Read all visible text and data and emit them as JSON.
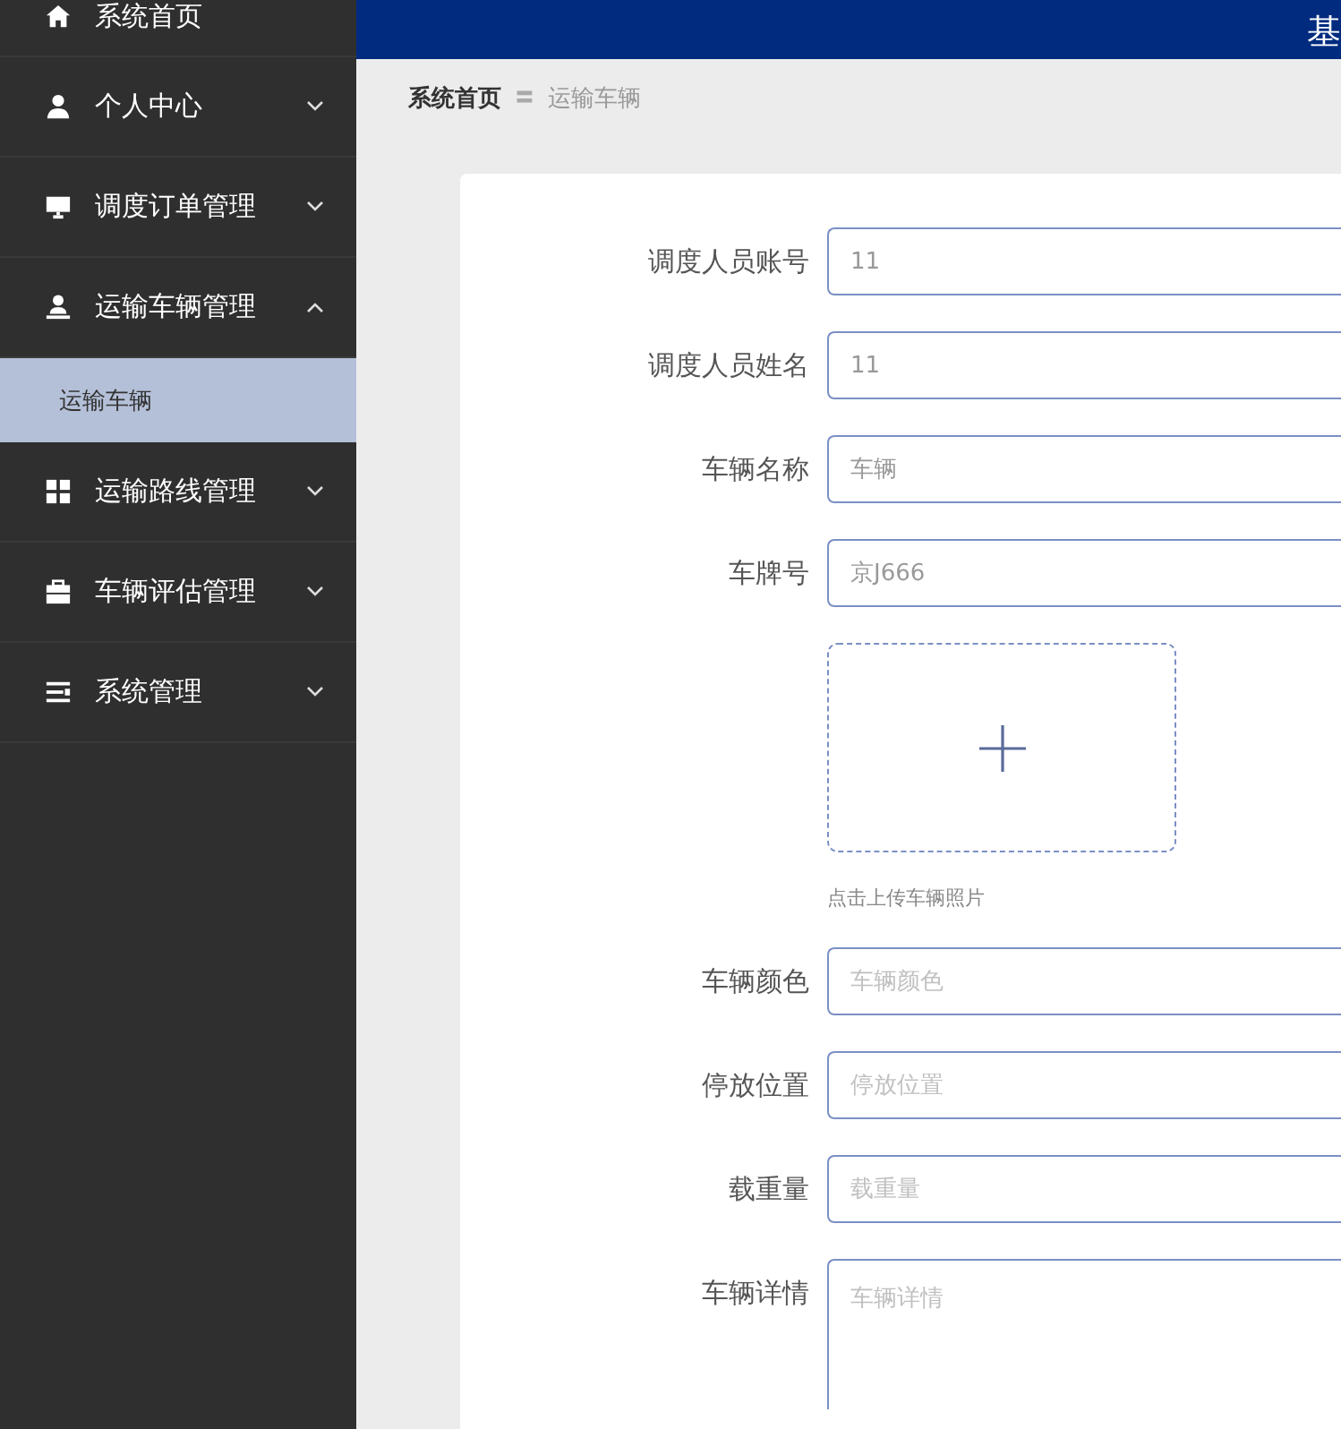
{
  "header": {
    "title": "基"
  },
  "sidebar": {
    "items": [
      {
        "label": "系统首页",
        "kind": "link"
      },
      {
        "label": "个人中心",
        "kind": "menu",
        "expanded": false
      },
      {
        "label": "调度订单管理",
        "kind": "menu",
        "expanded": false
      },
      {
        "label": "运输车辆管理",
        "kind": "menu",
        "expanded": true,
        "children": [
          {
            "label": "运输车辆",
            "selected": true
          }
        ]
      },
      {
        "label": "运输路线管理",
        "kind": "menu",
        "expanded": false
      },
      {
        "label": "车辆评估管理",
        "kind": "menu",
        "expanded": false
      },
      {
        "label": "系统管理",
        "kind": "menu",
        "expanded": false
      }
    ]
  },
  "breadcrumb": {
    "items": [
      "系统首页",
      "运输车辆"
    ],
    "separator": "〓"
  },
  "form": {
    "fields": [
      {
        "kind": "input",
        "label": "调度人员账号",
        "value": "11"
      },
      {
        "kind": "input",
        "label": "调度人员姓名",
        "value": "11"
      },
      {
        "kind": "input",
        "label": "车辆名称",
        "value": "车辆"
      },
      {
        "kind": "input",
        "label": "车牌号",
        "value": "京J666"
      },
      {
        "kind": "upload",
        "hint": "点击上传车辆照片"
      },
      {
        "kind": "input",
        "label": "车辆颜色",
        "placeholder": "车辆颜色"
      },
      {
        "kind": "input",
        "label": "停放位置",
        "placeholder": "停放位置"
      },
      {
        "kind": "input",
        "label": "载重量",
        "placeholder": "载重量"
      },
      {
        "kind": "textarea",
        "label": "车辆详情",
        "placeholder": "车辆详情"
      }
    ]
  }
}
